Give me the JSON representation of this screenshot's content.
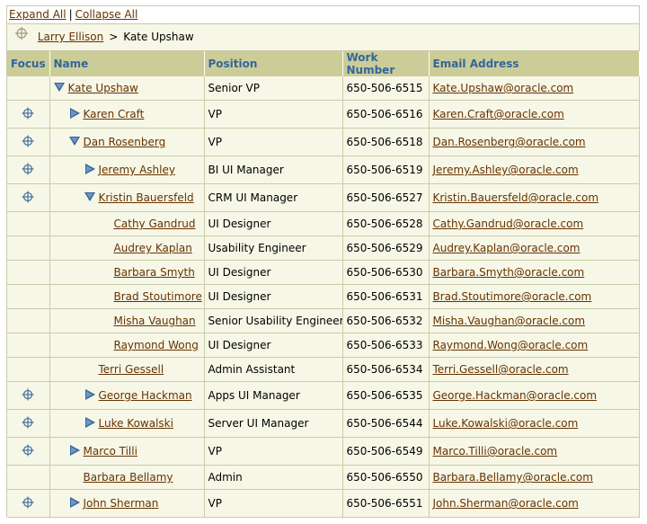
{
  "toolbar": {
    "expand_all": "Expand All",
    "separator": "|",
    "collapse_all": "Collapse All"
  },
  "breadcrumb": {
    "root": "Larry Ellison",
    "separator": ">",
    "current": "Kate Upshaw"
  },
  "columns": {
    "focus": "Focus",
    "name": "Name",
    "position": "Position",
    "work_number": "Work Number",
    "email": "Email Address"
  },
  "rows": [
    {
      "name": "Kate Upshaw",
      "position": "Senior VP",
      "phone": "650-506-6515",
      "email": "Kate.Upshaw@oracle.com",
      "level": 0,
      "toggle": "expanded",
      "focus": false
    },
    {
      "name": "Karen Craft",
      "position": "VP",
      "phone": "650-506-6516",
      "email": "Karen.Craft@oracle.com",
      "level": 1,
      "toggle": "collapsed",
      "focus": true
    },
    {
      "name": "Dan Rosenberg",
      "position": "VP",
      "phone": "650-506-6518",
      "email": "Dan.Rosenberg@oracle.com",
      "level": 1,
      "toggle": "expanded",
      "focus": true
    },
    {
      "name": "Jeremy Ashley",
      "position": "BI UI Manager",
      "phone": "650-506-6519",
      "email": "Jeremy.Ashley@oracle.com",
      "level": 2,
      "toggle": "collapsed",
      "focus": true
    },
    {
      "name": "Kristin Bauersfeld",
      "position": "CRM UI Manager",
      "phone": "650-506-6527",
      "email": "Kristin.Bauersfeld@oracle.com",
      "level": 2,
      "toggle": "expanded",
      "focus": true
    },
    {
      "name": "Cathy Gandrud",
      "position": "UI Designer",
      "phone": "650-506-6528",
      "email": "Cathy.Gandrud@oracle.com",
      "level": 3,
      "toggle": "none",
      "focus": false
    },
    {
      "name": "Audrey Kaplan",
      "position": "Usability Engineer",
      "phone": "650-506-6529",
      "email": "Audrey.Kaplan@oracle.com",
      "level": 3,
      "toggle": "none",
      "focus": false
    },
    {
      "name": "Barbara Smyth",
      "position": "UI Designer",
      "phone": "650-506-6530",
      "email": "Barbara.Smyth@oracle.com",
      "level": 3,
      "toggle": "none",
      "focus": false
    },
    {
      "name": "Brad Stoutimore",
      "position": "UI Designer",
      "phone": "650-506-6531",
      "email": "Brad.Stoutimore@oracle.com",
      "level": 3,
      "toggle": "none",
      "focus": false
    },
    {
      "name": "Misha Vaughan",
      "position": "Senior Usability Engineer",
      "phone": "650-506-6532",
      "email": "Misha.Vaughan@oracle.com",
      "level": 3,
      "toggle": "none",
      "focus": false
    },
    {
      "name": "Raymond Wong",
      "position": "UI Designer",
      "phone": "650-506-6533",
      "email": "Raymond.Wong@oracle.com",
      "level": 3,
      "toggle": "none",
      "focus": false
    },
    {
      "name": "Terri Gessell",
      "position": "Admin Assistant",
      "phone": "650-506-6534",
      "email": "Terri.Gessell@oracle.com",
      "level": 2,
      "toggle": "none",
      "focus": false
    },
    {
      "name": "George Hackman",
      "position": "Apps UI Manager",
      "phone": "650-506-6535",
      "email": "George.Hackman@oracle.com",
      "level": 2,
      "toggle": "collapsed",
      "focus": true
    },
    {
      "name": "Luke Kowalski",
      "position": "Server UI Manager",
      "phone": "650-506-6544",
      "email": "Luke.Kowalski@oracle.com",
      "level": 2,
      "toggle": "collapsed",
      "focus": true
    },
    {
      "name": "Marco Tilli",
      "position": "VP",
      "phone": "650-506-6549",
      "email": "Marco.Tilli@oracle.com",
      "level": 1,
      "toggle": "collapsed",
      "focus": true
    },
    {
      "name": "Barbara Bellamy",
      "position": "Admin",
      "phone": "650-506-6550",
      "email": "Barbara.Bellamy@oracle.com",
      "level": 1,
      "toggle": "none",
      "focus": false
    },
    {
      "name": "John Sherman",
      "position": "VP",
      "phone": "650-506-6551",
      "email": "John.Sherman@oracle.com",
      "level": 1,
      "toggle": "collapsed",
      "focus": true
    }
  ],
  "colors": {
    "header_bg": "#cccc99",
    "header_text": "#336699",
    "row_bg": "#f7f7e7",
    "link": "#663300",
    "icon_blue": "#336699"
  },
  "icons": {
    "focus": "focus-crosshair-icon",
    "expanded": "triangle-down-icon",
    "collapsed": "triangle-right-icon"
  }
}
